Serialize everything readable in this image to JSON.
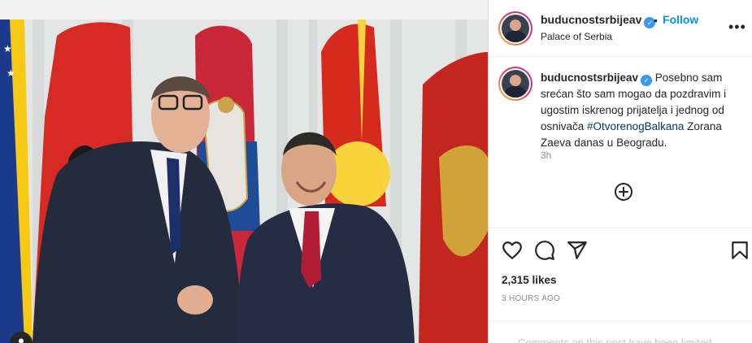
{
  "post": {
    "username": "buducnostsrbijeav",
    "location": "Palace of Serbia",
    "follow_label": "Follow",
    "separator": "•",
    "more_label": "•••",
    "verified_mark": "✓",
    "caption_user": "buducnostsrbijeav",
    "caption_text_1": "Posebno sam srećan što sam mogao da pozdravim i ugostim iskrenog prijatelja i jednog od osnivača ",
    "caption_hashtag": "#OtvorenogBalkana",
    "caption_text_2": " Zorana Zaeva danas u Beogradu.",
    "time": "3h",
    "likes": "2,315 likes",
    "time_ago": "3 HOURS AGO",
    "comments_limited": "Comments on this post have been limited."
  },
  "icons": {
    "tag": "user-tag-icon",
    "add": "add-circle-icon",
    "like": "heart-icon",
    "comment": "comment-icon",
    "share": "share-icon",
    "save": "bookmark-icon"
  },
  "colors": {
    "accent": "#0095f6",
    "verified": "#3897f0",
    "hashtag": "#00376b",
    "muted": "#8e8e8e"
  }
}
